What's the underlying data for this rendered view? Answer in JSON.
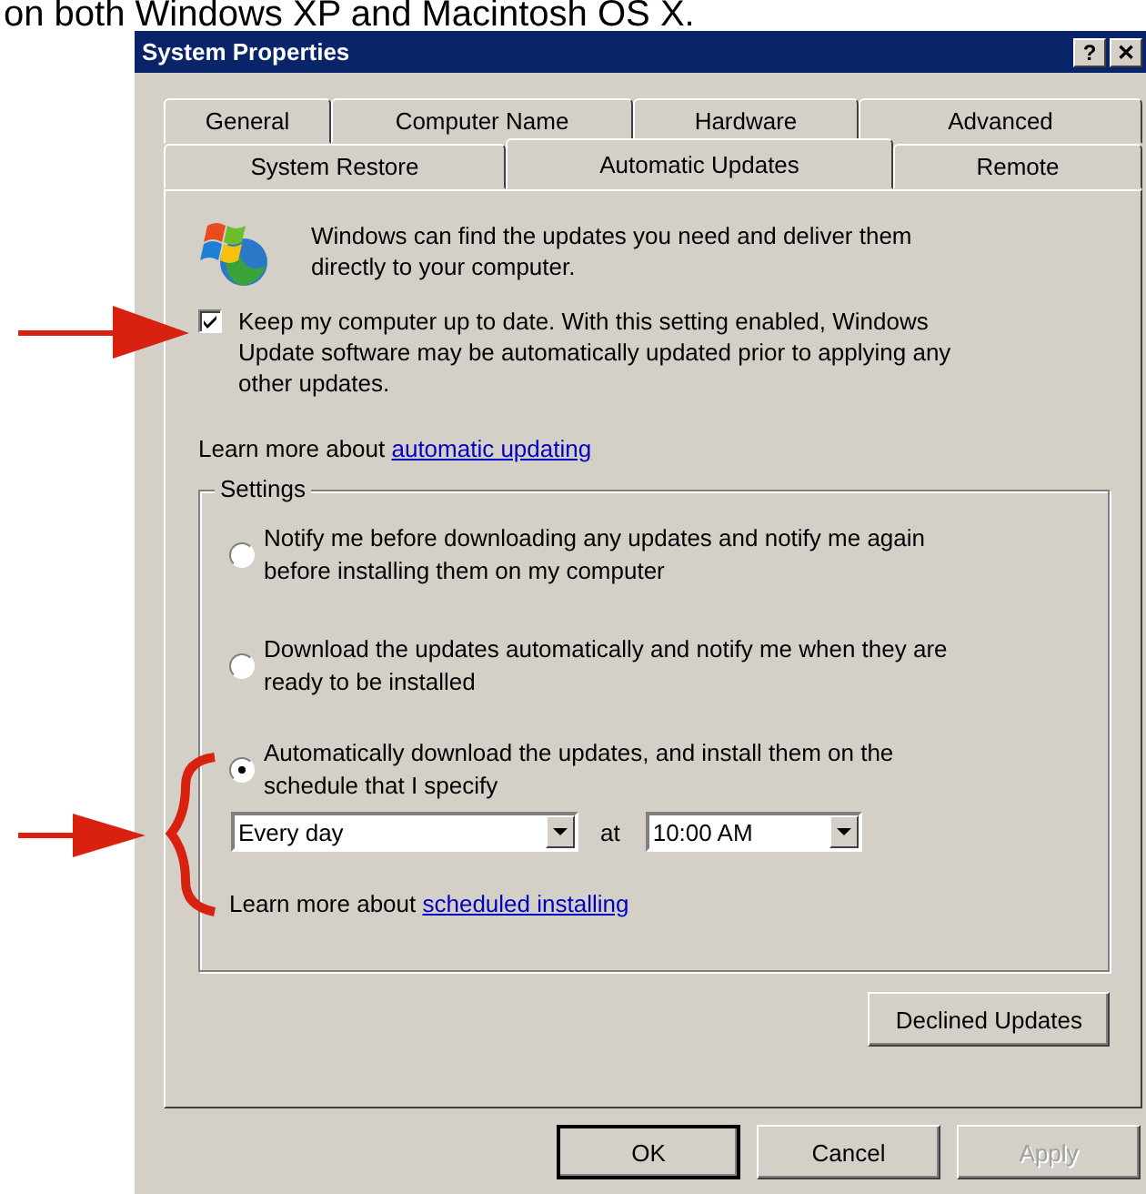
{
  "caption": "on both Windows XP and Macintosh OS X.",
  "window": {
    "title": "System Properties",
    "help_button": "?",
    "close_button": "✕"
  },
  "tab_rows": [
    [
      {
        "label": "General",
        "selected": false
      },
      {
        "label": "Computer Name",
        "selected": false
      },
      {
        "label": "Hardware",
        "selected": false
      },
      {
        "label": "Advanced",
        "selected": false
      }
    ],
    [
      {
        "label": "System Restore",
        "selected": false
      },
      {
        "label": "Automatic Updates",
        "selected": true
      },
      {
        "label": "Remote",
        "selected": false
      }
    ]
  ],
  "intro": "Windows can find the updates you need and deliver them directly to your computer.",
  "keep_up_to_date": {
    "label": "Keep my computer up to date. With this setting enabled, Windows Update software may be automatically updated prior to applying any other updates.",
    "checked": true
  },
  "learn_more": {
    "text": "Learn more about",
    "link": "automatic updating"
  },
  "settings": {
    "title": "Settings",
    "options": [
      {
        "label": "Notify me before downloading any updates and notify me again before installing them on my computer",
        "selected": false
      },
      {
        "label": "Download the updates automatically and notify me when they are ready to be installed",
        "selected": false
      },
      {
        "label": "Automatically download the updates, and install them on the schedule that I specify",
        "selected": true
      }
    ],
    "schedule": {
      "day": "Every day",
      "at": "at",
      "time": "10:00 AM"
    },
    "learn_more": {
      "text": "Learn more about",
      "link": "scheduled installing"
    }
  },
  "declined_button": "Declined Updates",
  "buttons": [
    {
      "label": "OK",
      "default": true,
      "disabled": false
    },
    {
      "label": "Cancel",
      "default": false,
      "disabled": false
    },
    {
      "label": "Apply",
      "default": false,
      "disabled": true
    }
  ]
}
